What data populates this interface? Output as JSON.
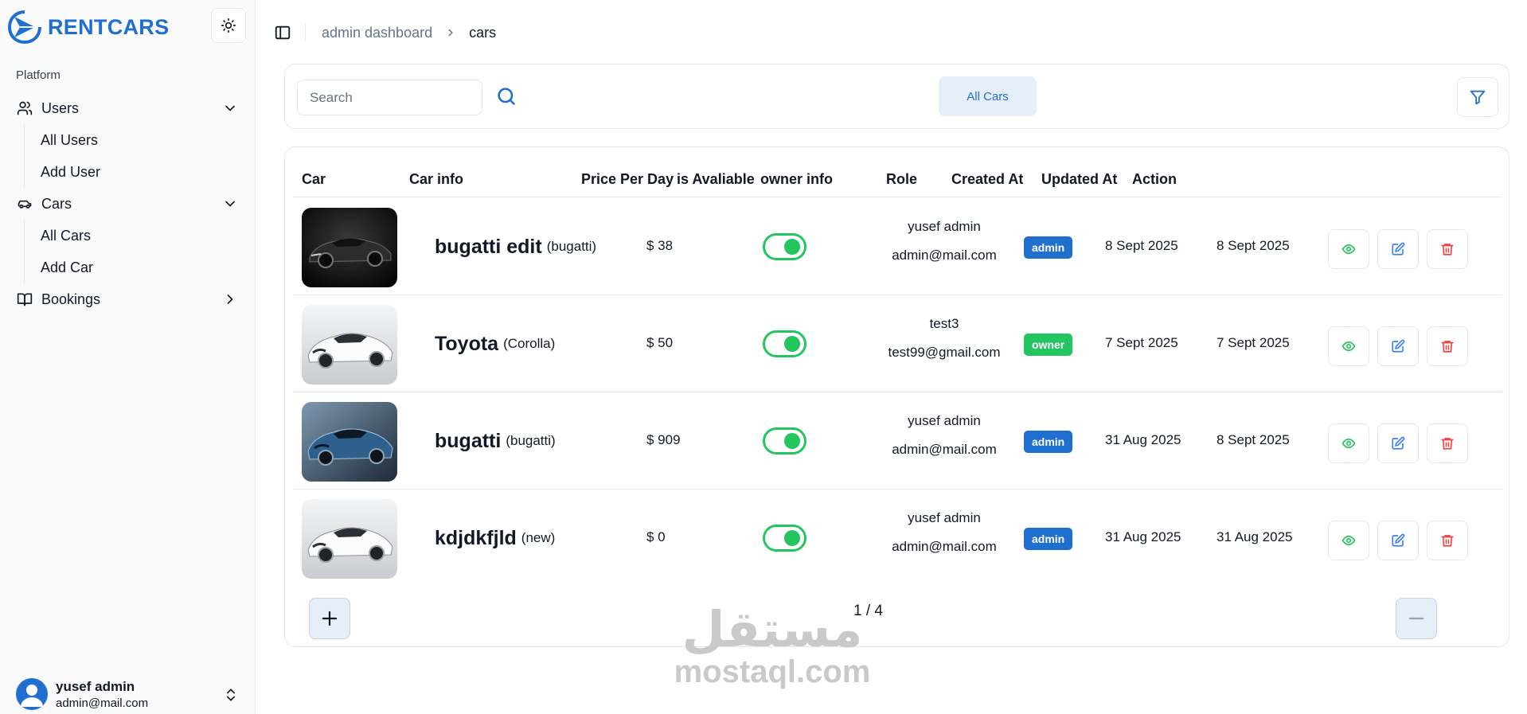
{
  "brand": {
    "name": "RENTCARS"
  },
  "sidebar": {
    "section_label": "Platform",
    "groups": [
      {
        "label": "Users",
        "icon": "users-icon",
        "expanded": true,
        "items": [
          {
            "label": "All Users"
          },
          {
            "label": "Add User"
          }
        ]
      },
      {
        "label": "Cars",
        "icon": "car-icon",
        "expanded": true,
        "items": [
          {
            "label": "All Cars"
          },
          {
            "label": "Add Car"
          }
        ]
      },
      {
        "label": "Bookings",
        "icon": "book-icon",
        "expanded": false,
        "items": []
      }
    ],
    "user": {
      "name": "yusef admin",
      "email": "admin@mail.com"
    }
  },
  "breadcrumb": {
    "parent": "admin dashboard",
    "current": "cars"
  },
  "filters": {
    "search_placeholder": "Search",
    "all_cars_label": "All Cars"
  },
  "table": {
    "headers": [
      "Car",
      "Car info",
      "Price Per Day",
      "is Avaliable",
      "owner info",
      "Role",
      "Created At",
      "Updated At",
      "Action"
    ],
    "rows": [
      {
        "name": "bugatti edit",
        "model": "(bugatti)",
        "price": "$ 38",
        "available": true,
        "owner_name": "yusef admin",
        "owner_email": "admin@mail.com",
        "role": "admin",
        "created": "8 Sept 2025",
        "updated": "8 Sept 2025",
        "image": "dark-sports-car"
      },
      {
        "name": "Toyota",
        "model": "(Corolla)",
        "price": "$ 50",
        "available": true,
        "owner_name": "test3",
        "owner_email": "test99@gmail.com",
        "role": "owner",
        "created": "7 Sept 2025",
        "updated": "7 Sept 2025",
        "image": "white-sports-car"
      },
      {
        "name": "bugatti",
        "model": "(bugatti)",
        "price": "$ 909",
        "available": true,
        "owner_name": "yusef admin",
        "owner_email": "admin@mail.com",
        "role": "admin",
        "created": "31 Aug 2025",
        "updated": "8 Sept 2025",
        "image": "blue-sports-car"
      },
      {
        "name": "kdjdkfjld",
        "model": "(new)",
        "price": "$ 0",
        "available": true,
        "owner_name": "yusef admin",
        "owner_email": "admin@mail.com",
        "role": "admin",
        "created": "31 Aug 2025",
        "updated": "31 Aug 2025",
        "image": "white-sports-car"
      }
    ]
  },
  "pagination": {
    "label": "1 / 4"
  },
  "watermark": {
    "arabic": "مستقل",
    "latin": "mostaql.com"
  },
  "colors": {
    "brand": "#1e6fd0",
    "admin_badge": "#1e6fd0",
    "owner_badge": "#22c55e",
    "view": "#22c55e",
    "edit": "#3b82f6",
    "delete": "#ef4444",
    "toggle_on": "#22c55e"
  }
}
